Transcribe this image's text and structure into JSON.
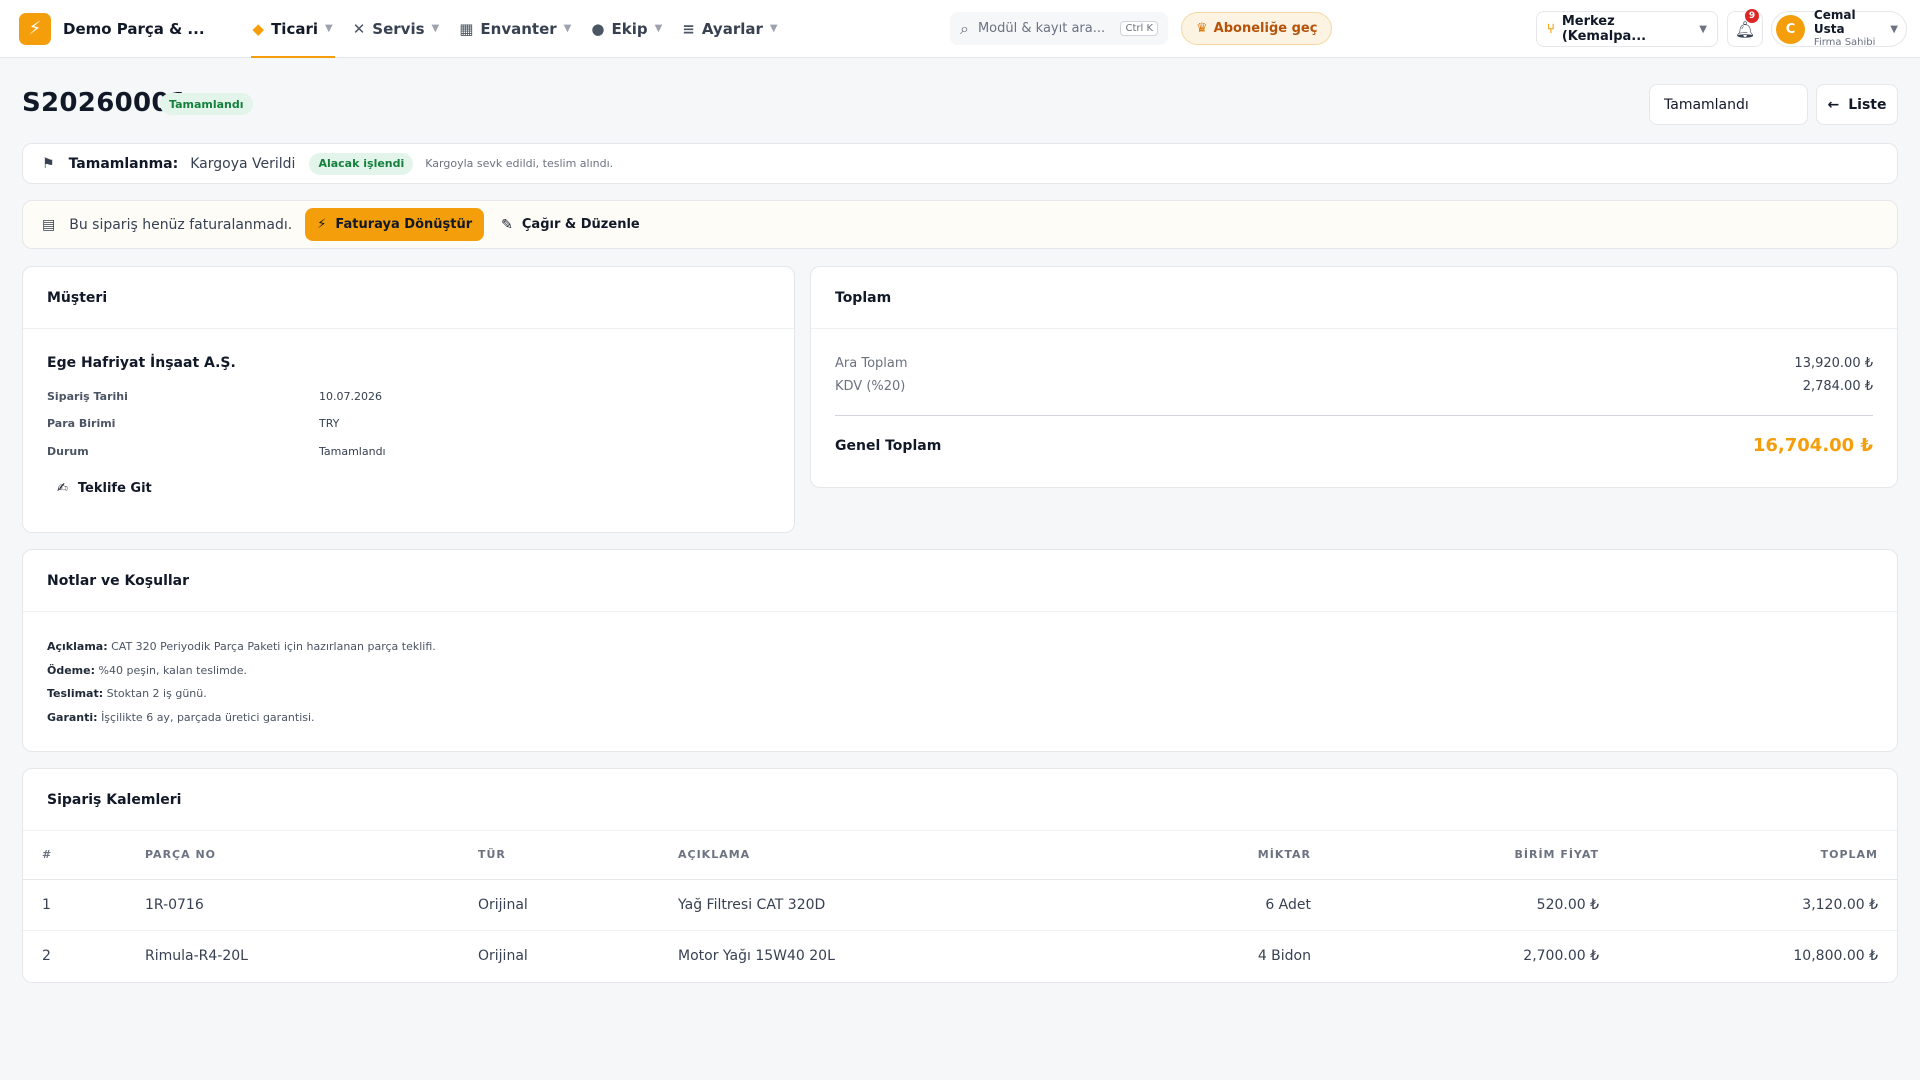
{
  "brand": {
    "logo_glyph": "⚡",
    "name": "Demo Parça & ..."
  },
  "nav": [
    {
      "label": "Ticari",
      "icon": "handshake-icon",
      "active": true
    },
    {
      "label": "Servis",
      "icon": "tools-icon",
      "active": false
    },
    {
      "label": "Envanter",
      "icon": "warehouse-icon",
      "active": false
    },
    {
      "label": "Ekip",
      "icon": "users-icon",
      "active": false
    },
    {
      "label": "Ayarlar",
      "icon": "sliders-icon",
      "active": false
    }
  ],
  "search": {
    "placeholder": "Modül & kayıt ara...",
    "shortcut": "Ctrl K"
  },
  "upgrade": {
    "label": "Aboneliğe geç"
  },
  "branch": {
    "label": "Merkez (Kemalpa..."
  },
  "notifications": {
    "count": "9"
  },
  "user": {
    "initial": "C",
    "name": "Cemal Usta",
    "role": "Firma Sahibi"
  },
  "header": {
    "order_no": "S20260001",
    "status_badge": "Tamamlandı",
    "status_select": "Tamamlandı",
    "list_button": "Liste"
  },
  "completion": {
    "label": "Tamamlanma:",
    "value": "Kargoya Verildi",
    "badge": "Alacak işlendi",
    "note": "Kargoyla sevk edildi, teslim alındı."
  },
  "invoice": {
    "text": "Bu sipariş henüz faturalanmadı.",
    "convert_button": "Faturaya Dönüştür",
    "edit_button": "Çağır & Düzenle"
  },
  "customer": {
    "title": "Müşteri",
    "name": "Ege Hafriyat İnşaat A.Ş.",
    "fields": [
      {
        "key": "Sipariş Tarihi",
        "value": "10.07.2026"
      },
      {
        "key": "Para Birimi",
        "value": "TRY"
      },
      {
        "key": "Durum",
        "value": "Tamamlandı"
      }
    ],
    "quote_link": "Teklife Git"
  },
  "totals": {
    "title": "Toplam",
    "subtotal_label": "Ara Toplam",
    "subtotal": "13,920.00 ₺",
    "vat_label": "KDV (%20)",
    "vat": "2,784.00 ₺",
    "grand_label": "Genel Toplam",
    "grand": "16,704.00 ₺"
  },
  "notes": {
    "title": "Notlar ve Koşullar",
    "lines": [
      {
        "key": "Açıklama:",
        "value": "CAT 320 Periyodik Parça Paketi için hazırlanan parça teklifi."
      },
      {
        "key": "Ödeme:",
        "value": "%40 peşin, kalan teslimde."
      },
      {
        "key": "Teslimat:",
        "value": "Stoktan 2 iş günü."
      },
      {
        "key": "Garanti:",
        "value": "İşçilikte 6 ay, parçada üretici garantisi."
      }
    ]
  },
  "items": {
    "title": "Sipariş Kalemleri",
    "columns": [
      "#",
      "PARÇA NO",
      "TÜR",
      "AÇIKLAMA",
      "MİKTAR",
      "BİRİM FİYAT",
      "TOPLAM"
    ],
    "rows": [
      [
        "1",
        "1R-0716",
        "Orijinal",
        "Yağ Filtresi CAT 320D",
        "6 Adet",
        "520.00 ₺",
        "3,120.00 ₺"
      ],
      [
        "2",
        "Rimula-R4-20L",
        "Orijinal",
        "Motor Yağı 15W40 20L",
        "4 Bidon",
        "2,700.00 ₺",
        "10,800.00 ₺"
      ]
    ]
  },
  "colors": {
    "accent": "#f59e0b",
    "success_bg": "#e3f5ea",
    "success_text": "#15803d",
    "danger": "#dc2626"
  }
}
